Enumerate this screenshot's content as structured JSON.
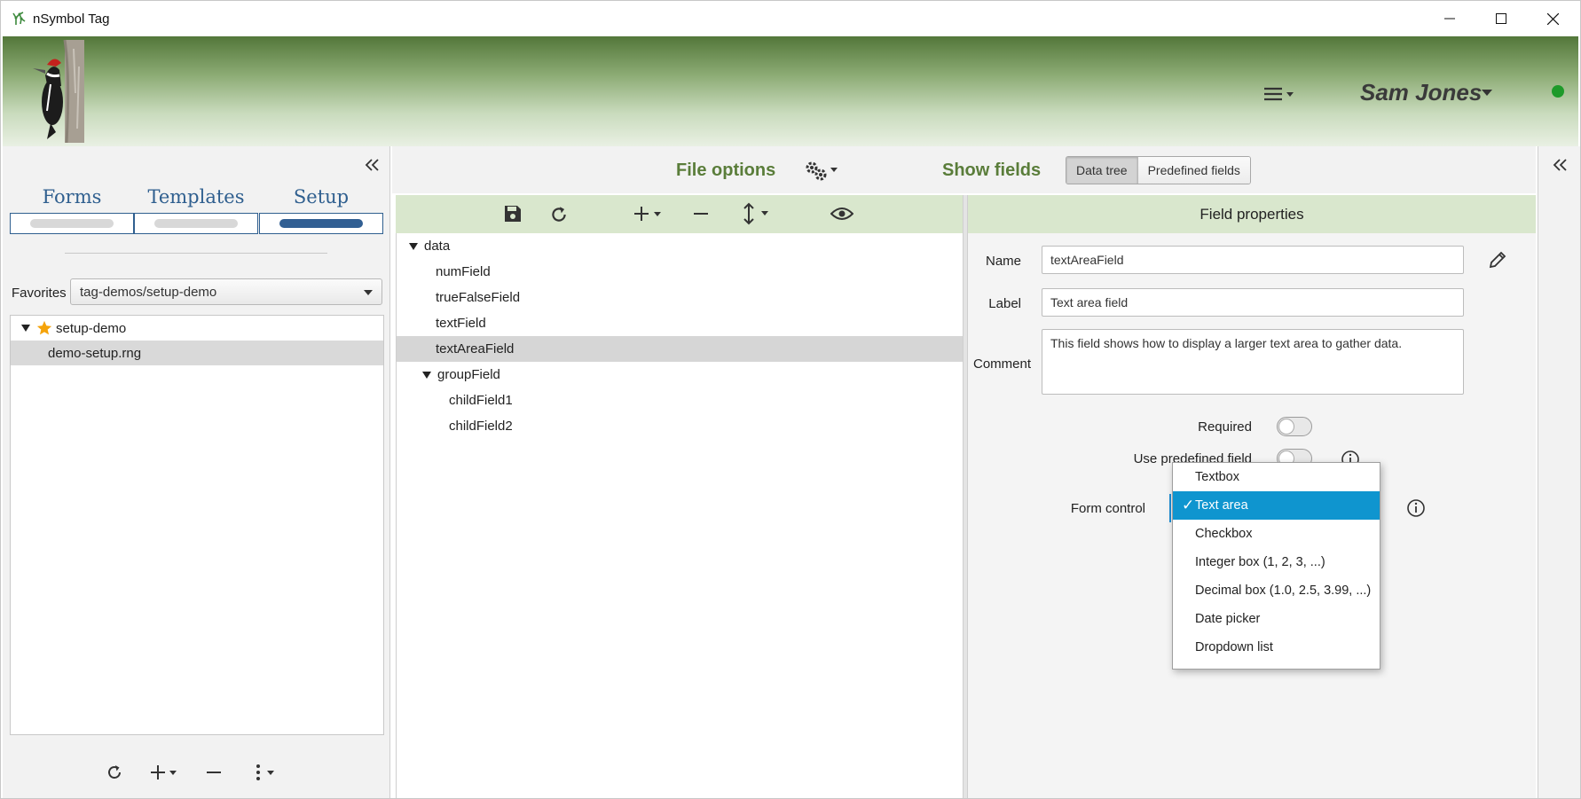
{
  "window": {
    "title": "nSymbol Tag",
    "minimize_label": "—",
    "maximize_label": "☐",
    "close_label": "✕"
  },
  "header": {
    "user_name": "Sam Jones",
    "status_color": "#1e9a2a"
  },
  "left_panel": {
    "tabs": [
      {
        "label": "Forms",
        "active": false
      },
      {
        "label": "Templates",
        "active": false
      },
      {
        "label": "Setup",
        "active": true
      }
    ],
    "favorites_label": "Favorites",
    "favorites_value": "tag-demos/setup-demo",
    "tree": [
      {
        "label": "setup-demo",
        "expanded": true,
        "starred": true,
        "selected": false
      },
      {
        "label": "demo-setup.rng",
        "selected": true
      }
    ],
    "bottom_icons": [
      "refresh-icon",
      "add-icon",
      "remove-icon",
      "more-icon"
    ]
  },
  "topbar": {
    "file_options_label": "File options",
    "show_fields_label": "Show fields",
    "view_toggle": [
      {
        "label": "Data tree",
        "active": true
      },
      {
        "label": "Predefined fields",
        "active": false
      }
    ]
  },
  "data_tree": {
    "toolbar_icons": [
      "save-icon",
      "reload-icon",
      "add-icon",
      "remove-icon",
      "move-icon",
      "preview-icon"
    ],
    "rows": [
      {
        "label": "data",
        "level": 0,
        "expander": true,
        "selected": false
      },
      {
        "label": "numField",
        "level": 1,
        "expander": false,
        "selected": false
      },
      {
        "label": "trueFalseField",
        "level": 1,
        "expander": false,
        "selected": false
      },
      {
        "label": "textField",
        "level": 1,
        "expander": false,
        "selected": false
      },
      {
        "label": "textAreaField",
        "level": 1,
        "expander": false,
        "selected": true
      },
      {
        "label": "groupField",
        "level": 1,
        "expander": true,
        "selected": false
      },
      {
        "label": "childField1",
        "level": 2,
        "expander": false,
        "selected": false
      },
      {
        "label": "childField2",
        "level": 2,
        "expander": false,
        "selected": false
      }
    ]
  },
  "field_properties": {
    "header": "Field properties",
    "name_label": "Name",
    "name_value": "textAreaField",
    "label_label": "Label",
    "label_value": "Text area field",
    "comment_label": "Comment",
    "comment_value": "This field shows how to display a larger text area to gather data.",
    "required_label": "Required",
    "required_on": false,
    "use_predefined_label": "Use predefined field",
    "use_predefined_on": false,
    "form_control_label": "Form control",
    "form_control_options": [
      {
        "label": "Textbox",
        "selected": false
      },
      {
        "label": "Text area",
        "selected": true
      },
      {
        "label": "Checkbox",
        "selected": false
      },
      {
        "label": "Integer box (1, 2, 3, ...)",
        "selected": false
      },
      {
        "label": "Decimal box (1.0, 2.5, 3.99, ...)",
        "selected": false
      },
      {
        "label": "Date picker",
        "selected": false
      },
      {
        "label": "Dropdown list",
        "selected": false
      }
    ],
    "check_mark": "✓"
  },
  "colors": {
    "accent_green": "#5a7d3a",
    "panel_header_green": "#d9e7cd",
    "tab_blue": "#2f5f8f",
    "selection_blue": "#0f95cf"
  }
}
